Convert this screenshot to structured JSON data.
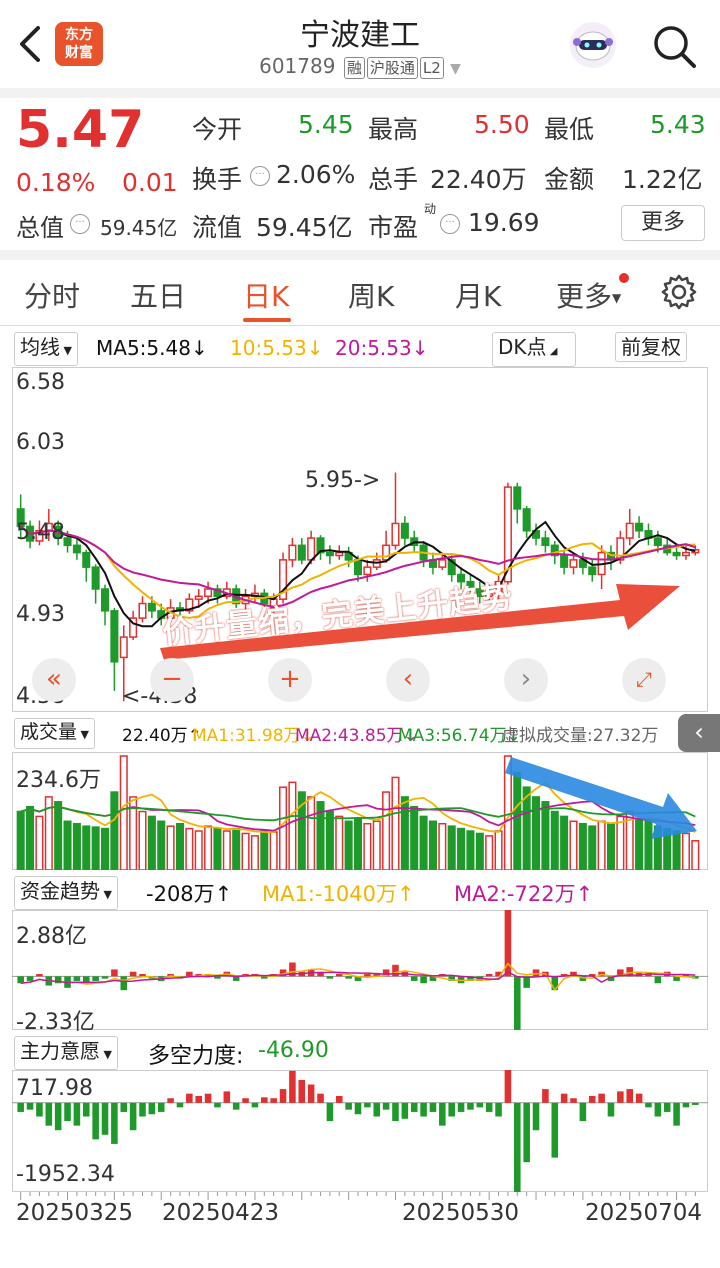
{
  "header": {
    "stock_name": "宁波建工",
    "stock_code": "601789",
    "tags": [
      "融",
      "沪股通",
      "L2"
    ],
    "logo_text": "东方财富"
  },
  "quote": {
    "price": "5.47",
    "change_pct": "0.18%",
    "change": "0.01",
    "open_label": "今开",
    "open": "5.45",
    "high_label": "最高",
    "high": "5.50",
    "low_label": "最低",
    "low": "5.43",
    "turnover_label": "换手",
    "turnover": "2.06%",
    "volume_label": "总手",
    "volume": "22.40万",
    "amount_label": "金额",
    "amount": "1.22亿",
    "mktcap_label": "总值",
    "mktcap": "59.45亿",
    "float_label": "流值",
    "float_cap": "59.45亿",
    "pe_label": "市盈",
    "pe_sup": "动",
    "pe": "19.69",
    "more_label": "更多"
  },
  "tabs": [
    {
      "label": "分时"
    },
    {
      "label": "五日"
    },
    {
      "label": "日K"
    },
    {
      "label": "周K"
    },
    {
      "label": "月K"
    },
    {
      "label": "更多"
    }
  ],
  "kline": {
    "ma_select": "均线",
    "ma5": "MA5:5.48",
    "ma10": "10:5.53",
    "ma20": "20:5.53",
    "dk_label": "DK点",
    "adjust_label": "前复权",
    "y_labels": [
      "6.58",
      "6.03",
      "5.48",
      "4.93",
      "4.38"
    ],
    "peak_annotation": "5.95->",
    "low_annotation": "<-4.38",
    "overlay_text": "价升量缩，完美上升趋势",
    "colors": {
      "up": "#e03030",
      "down": "#1e9a2a",
      "ma5": "#111111",
      "ma10": "#f0b400",
      "ma20": "#c0199a"
    }
  },
  "volume": {
    "select": "成交量",
    "value": "22.40万↑",
    "ma1": "MA1:31.98万↓",
    "ma2": "MA2:43.85万↓",
    "ma3": "MA3:56.74万↓",
    "virtual": "虚拟成交量:27.32万",
    "y_label": "234.6万"
  },
  "fund": {
    "select": "资金趋势",
    "value": "-208万↑",
    "ma1": "MA1:-1040万↑",
    "ma2": "MA2:-722万↑",
    "y_top": "2.88亿",
    "y_bottom": "-2.33亿"
  },
  "main_force": {
    "select": "主力意愿",
    "label": "多空力度:",
    "value": "-46.90",
    "y_top": "717.98",
    "y_bottom": "-1952.34"
  },
  "dates": [
    "20250325",
    "20250423",
    "20250530",
    "20250704"
  ],
  "chart_data": {
    "type": "candlestick",
    "candles": [
      [
        5.7,
        5.58,
        5.8,
        5.5
      ],
      [
        5.58,
        5.48,
        5.62,
        5.43
      ],
      [
        5.48,
        5.55,
        5.62,
        5.45
      ],
      [
        5.55,
        5.6,
        5.7,
        5.48
      ],
      [
        5.58,
        5.5,
        5.62,
        5.45
      ],
      [
        5.5,
        5.45,
        5.55,
        5.4
      ],
      [
        5.45,
        5.4,
        5.5,
        5.35
      ],
      [
        5.4,
        5.3,
        5.42,
        5.2
      ],
      [
        5.3,
        5.15,
        5.32,
        5.05
      ],
      [
        5.15,
        5.0,
        5.18,
        4.9
      ],
      [
        5.0,
        4.65,
        5.02,
        4.45
      ],
      [
        4.68,
        4.82,
        4.9,
        4.38
      ],
      [
        4.82,
        4.95,
        5.0,
        4.8
      ],
      [
        4.95,
        5.05,
        5.1,
        4.92
      ],
      [
        5.05,
        5.0,
        5.1,
        4.95
      ],
      [
        5.0,
        4.95,
        5.05,
        4.9
      ],
      [
        4.95,
        5.02,
        5.08,
        4.92
      ],
      [
        5.02,
        5.0,
        5.06,
        4.95
      ],
      [
        5.0,
        5.08,
        5.12,
        4.98
      ],
      [
        5.08,
        5.1,
        5.15,
        5.02
      ],
      [
        5.1,
        5.15,
        5.2,
        5.05
      ],
      [
        5.15,
        5.1,
        5.18,
        5.05
      ],
      [
        5.1,
        5.15,
        5.2,
        5.08
      ],
      [
        5.15,
        5.05,
        5.18,
        5.02
      ],
      [
        5.05,
        5.1,
        5.15,
        5.0
      ],
      [
        5.1,
        5.12,
        5.18,
        5.05
      ],
      [
        5.12,
        5.05,
        5.15,
        5.0
      ],
      [
        5.02,
        5.08,
        5.12,
        4.98
      ],
      [
        5.08,
        5.35,
        5.4,
        5.05
      ],
      [
        5.35,
        5.45,
        5.5,
        5.3
      ],
      [
        5.45,
        5.35,
        5.5,
        5.32
      ],
      [
        5.35,
        5.5,
        5.55,
        5.32
      ],
      [
        5.5,
        5.4,
        5.52,
        5.35
      ],
      [
        5.4,
        5.38,
        5.45,
        5.32
      ],
      [
        5.38,
        5.4,
        5.45,
        5.35
      ],
      [
        5.4,
        5.35,
        5.44,
        5.3
      ],
      [
        5.35,
        5.25,
        5.38,
        5.2
      ],
      [
        5.25,
        5.3,
        5.35,
        5.2
      ],
      [
        5.3,
        5.35,
        5.4,
        5.28
      ],
      [
        5.35,
        5.45,
        5.55,
        5.33
      ],
      [
        5.45,
        5.6,
        5.95,
        5.42
      ],
      [
        5.6,
        5.5,
        5.65,
        5.45
      ],
      [
        5.5,
        5.45,
        5.55,
        5.4
      ],
      [
        5.45,
        5.35,
        5.48,
        5.3
      ],
      [
        5.35,
        5.3,
        5.4,
        5.25
      ],
      [
        5.3,
        5.35,
        5.4,
        5.28
      ],
      [
        5.35,
        5.25,
        5.38,
        5.2
      ],
      [
        5.25,
        5.2,
        5.3,
        5.15
      ],
      [
        5.2,
        5.15,
        5.25,
        5.1
      ],
      [
        5.15,
        5.1,
        5.2,
        5.05
      ],
      [
        5.1,
        5.12,
        5.18,
        5.05
      ],
      [
        5.12,
        5.2,
        5.25,
        5.08
      ],
      [
        5.2,
        5.85,
        5.88,
        5.18
      ],
      [
        5.85,
        5.7,
        5.88,
        5.6
      ],
      [
        5.7,
        5.55,
        5.72,
        5.5
      ],
      [
        5.55,
        5.5,
        5.6,
        5.45
      ],
      [
        5.5,
        5.45,
        5.55,
        5.4
      ],
      [
        5.45,
        5.38,
        5.48,
        5.32
      ],
      [
        5.38,
        5.3,
        5.42,
        5.25
      ],
      [
        5.3,
        5.35,
        5.4,
        5.25
      ],
      [
        5.35,
        5.3,
        5.4,
        5.25
      ],
      [
        5.3,
        5.25,
        5.35,
        5.2
      ],
      [
        5.25,
        5.4,
        5.45,
        5.15
      ],
      [
        5.4,
        5.35,
        5.45,
        5.28
      ],
      [
        5.35,
        5.5,
        5.55,
        5.32
      ],
      [
        5.5,
        5.6,
        5.7,
        5.45
      ],
      [
        5.6,
        5.55,
        5.65,
        5.5
      ],
      [
        5.55,
        5.5,
        5.6,
        5.45
      ],
      [
        5.5,
        5.45,
        5.55,
        5.4
      ],
      [
        5.45,
        5.4,
        5.5,
        5.38
      ],
      [
        5.4,
        5.38,
        5.45,
        5.35
      ],
      [
        5.38,
        5.4,
        5.45,
        5.35
      ],
      [
        5.4,
        5.42,
        5.45,
        5.38
      ]
    ],
    "volume": [
      120,
      130,
      110,
      150,
      140,
      100,
      95,
      90,
      88,
      85,
      160,
      234,
      150,
      120,
      110,
      100,
      90,
      95,
      85,
      80,
      90,
      85,
      80,
      85,
      75,
      70,
      80,
      78,
      170,
      180,
      160,
      150,
      140,
      120,
      110,
      100,
      105,
      95,
      100,
      160,
      190,
      150,
      130,
      110,
      100,
      95,
      90,
      85,
      80,
      75,
      70,
      80,
      234,
      200,
      170,
      150,
      140,
      120,
      110,
      100,
      95,
      90,
      100,
      95,
      110,
      120,
      105,
      100,
      90,
      85,
      80,
      75,
      60
    ],
    "fund": [
      -0.3,
      -0.2,
      0.1,
      -0.4,
      -0.3,
      -0.5,
      -0.2,
      -0.3,
      -0.2,
      -0.1,
      0.3,
      -0.6,
      0.2,
      0.1,
      -0.1,
      -0.2,
      0.1,
      -0.1,
      0.2,
      0.1,
      0.1,
      -0.1,
      0.2,
      -0.2,
      0.1,
      0.1,
      -0.1,
      0.1,
      0.3,
      0.6,
      0.2,
      0.3,
      0.2,
      -0.1,
      0.1,
      -0.1,
      -0.2,
      0.1,
      0.1,
      0.3,
      0.5,
      0.2,
      -0.2,
      -0.3,
      -0.2,
      0.1,
      -0.2,
      -0.3,
      -0.2,
      -0.2,
      0.1,
      0.2,
      2.88,
      -2.33,
      -0.5,
      0.3,
      0.2,
      -0.6,
      0.1,
      0.2,
      -0.2,
      0.1,
      0.2,
      -0.2,
      0.3,
      0.4,
      0.2,
      0.1,
      -0.3,
      0.2,
      -0.2,
      0.1,
      -0.1
    ],
    "main_force": [
      -200,
      -150,
      -300,
      -500,
      -600,
      -400,
      -500,
      -300,
      -800,
      -700,
      -900,
      -200,
      -600,
      -300,
      -250,
      -200,
      100,
      -100,
      200,
      150,
      200,
      -100,
      250,
      -150,
      100,
      -100,
      120,
      100,
      300,
      700,
      500,
      400,
      200,
      -400,
      150,
      -150,
      -250,
      -100,
      -300,
      -150,
      -400,
      -350,
      -200,
      -300,
      -200,
      -500,
      -300,
      -200,
      -150,
      -100,
      -200,
      -300,
      718,
      -1952,
      -1300,
      -600,
      300,
      -1200,
      200,
      100,
      -400,
      150,
      200,
      -300,
      250,
      300,
      200,
      -100,
      -300,
      -200,
      -500,
      -100,
      -47
    ]
  }
}
